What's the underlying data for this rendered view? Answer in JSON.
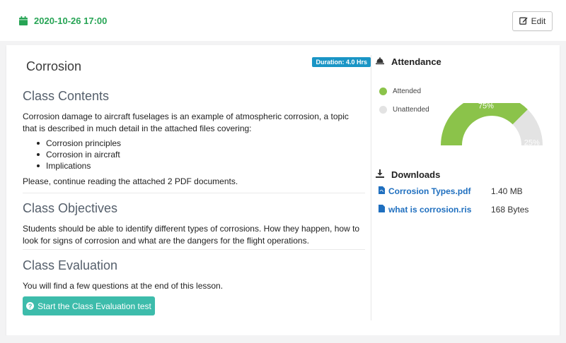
{
  "header": {
    "date": "2020-10-26 17:00",
    "edit_label": "Edit"
  },
  "lesson": {
    "title": "Corrosion",
    "duration": "Duration: 4.0 Hrs"
  },
  "contents": {
    "title": "Class Contents",
    "intro": "Corrosion damage to aircraft fuselages is an example of atmospheric corrosion, a topic that is described in much detail in the attached files covering:",
    "items": [
      "Corrosion principles",
      "Corrosion in aircraft",
      "Implications"
    ],
    "outro": "Please, continue reading the attached 2 PDF documents."
  },
  "objectives": {
    "title": "Class Objectives",
    "text": "Students should be able to identify different types of corrosions. How they happen, how to look for signs of corrosion and what are the dangers for the flight operations."
  },
  "evaluation": {
    "title": "Class Evaluation",
    "text": "You will find a few questions at the end of this lesson.",
    "button_label": "Start the Class Evaluation test"
  },
  "attendance": {
    "title": "Attendance",
    "legend": [
      {
        "label": "Attended",
        "color": "#8bc34a"
      },
      {
        "label": "Unattended",
        "color": "#e3e3e3"
      }
    ],
    "attended_pct": 75,
    "attended_label": "75%",
    "unattended_label": "25%"
  },
  "downloads": {
    "title": "Downloads",
    "files": [
      {
        "name": "Corrosion Types.pdf",
        "size": "1.40 MB",
        "icon": "pdf-file-icon"
      },
      {
        "name": "what is corrosion.ris",
        "size": "168 Bytes",
        "icon": "file-icon"
      }
    ]
  },
  "colors": {
    "accent_green": "#27a455",
    "duration_badge": "#1a95c5",
    "eval_button": "#3dbcab",
    "link": "#1f6fbf"
  }
}
